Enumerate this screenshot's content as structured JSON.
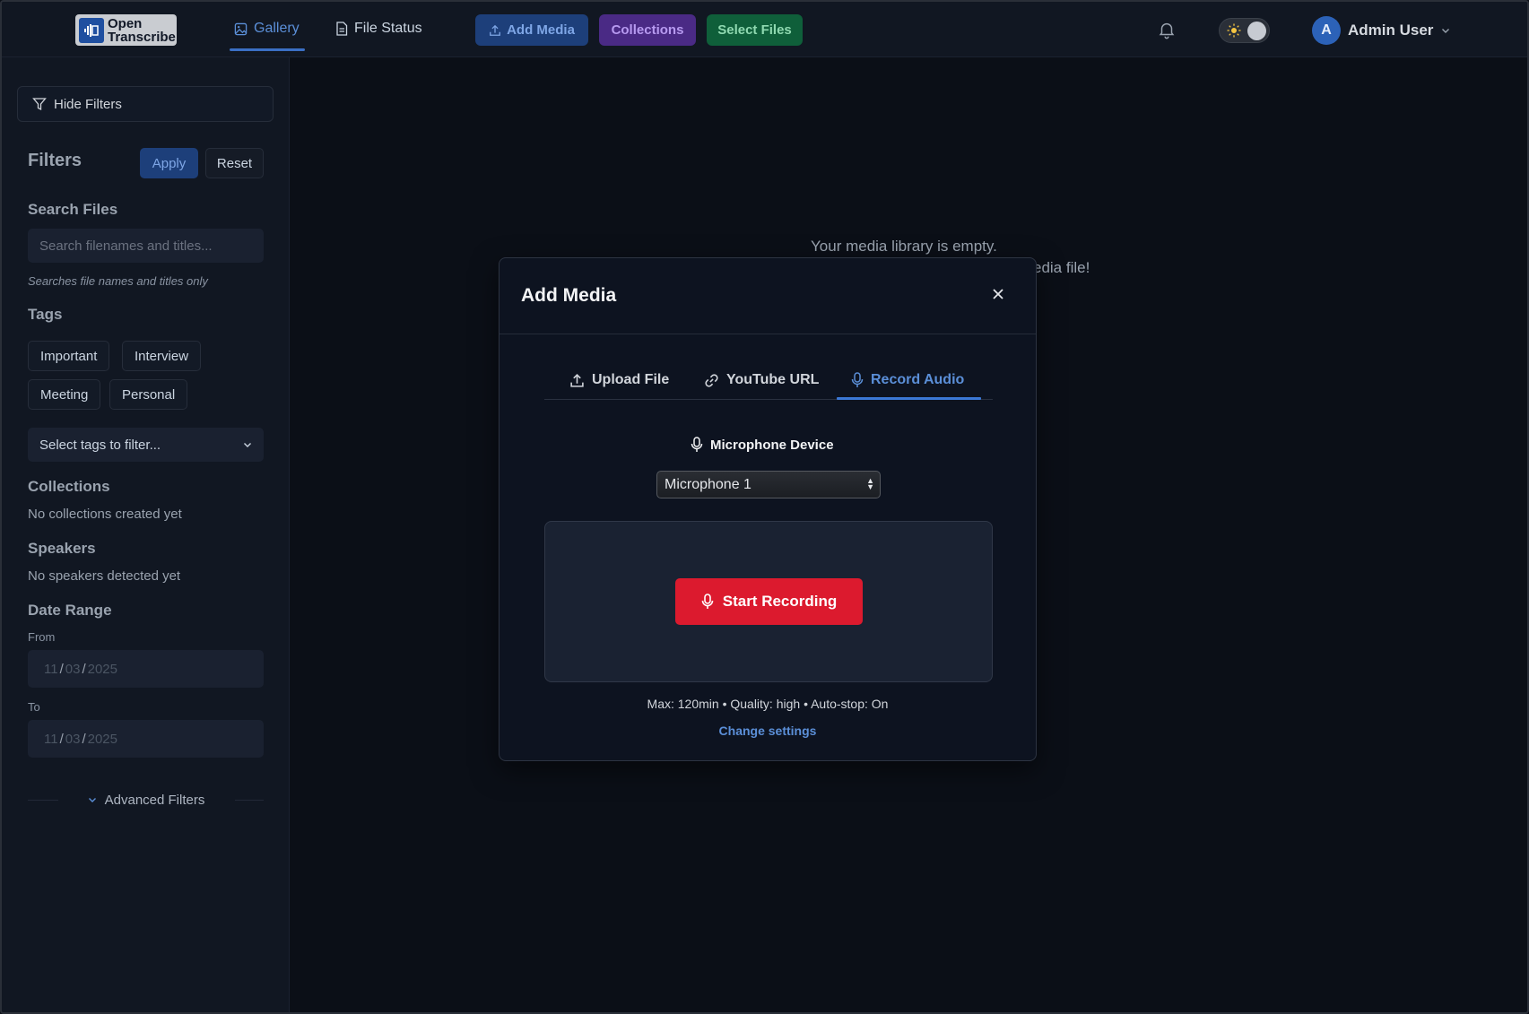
{
  "app": {
    "logo_line1": "Open",
    "logo_line2": "Transcribe"
  },
  "nav": {
    "tabs": [
      {
        "label": "Gallery",
        "icon": "image-icon",
        "active": true
      },
      {
        "label": "File Status",
        "icon": "document-icon",
        "active": false
      }
    ],
    "buttons": {
      "add_media": "Add Media",
      "collections": "Collections",
      "select_files": "Select Files"
    },
    "user": {
      "initial": "A",
      "name": "Admin User"
    }
  },
  "sidebar": {
    "hide_filters": "Hide Filters",
    "filters_title": "Filters",
    "apply": "Apply",
    "reset": "Reset",
    "search": {
      "title": "Search Files",
      "placeholder": "Search filenames and titles...",
      "hint": "Searches file names and titles only"
    },
    "tags": {
      "title": "Tags",
      "items": [
        "Important",
        "Interview",
        "Meeting",
        "Personal"
      ],
      "select_placeholder": "Select tags to filter..."
    },
    "collections": {
      "title": "Collections",
      "empty": "No collections created yet"
    },
    "speakers": {
      "title": "Speakers",
      "empty": "No speakers detected yet"
    },
    "date_range": {
      "title": "Date Range",
      "from_label": "From",
      "to_label": "To",
      "from": {
        "month": "11",
        "day": "03",
        "year": "2025"
      },
      "to": {
        "month": "11",
        "day": "03",
        "year": "2025"
      }
    },
    "advanced_filters": "Advanced Filters"
  },
  "main": {
    "empty_line1": "Your media library is empty.",
    "empty_line2_visible": "edia file!"
  },
  "modal": {
    "title": "Add Media",
    "tabs": [
      {
        "label": "Upload File",
        "icon": "upload-icon",
        "active": false
      },
      {
        "label": "YouTube URL",
        "icon": "link-icon",
        "active": false
      },
      {
        "label": "Record Audio",
        "icon": "microphone-icon",
        "active": true
      }
    ],
    "mic_device_label": "Microphone Device",
    "mic_selected": "Microphone 1",
    "start_recording": "Start Recording",
    "recording_info": "Max: 120min • Quality: high • Auto-stop: On",
    "change_settings": "Change settings"
  },
  "colors": {
    "accent_blue": "#3b78d6",
    "record_red": "#dc1a2e",
    "collections_purple": "#4a2a85",
    "select_green": "#0f5f3a"
  }
}
